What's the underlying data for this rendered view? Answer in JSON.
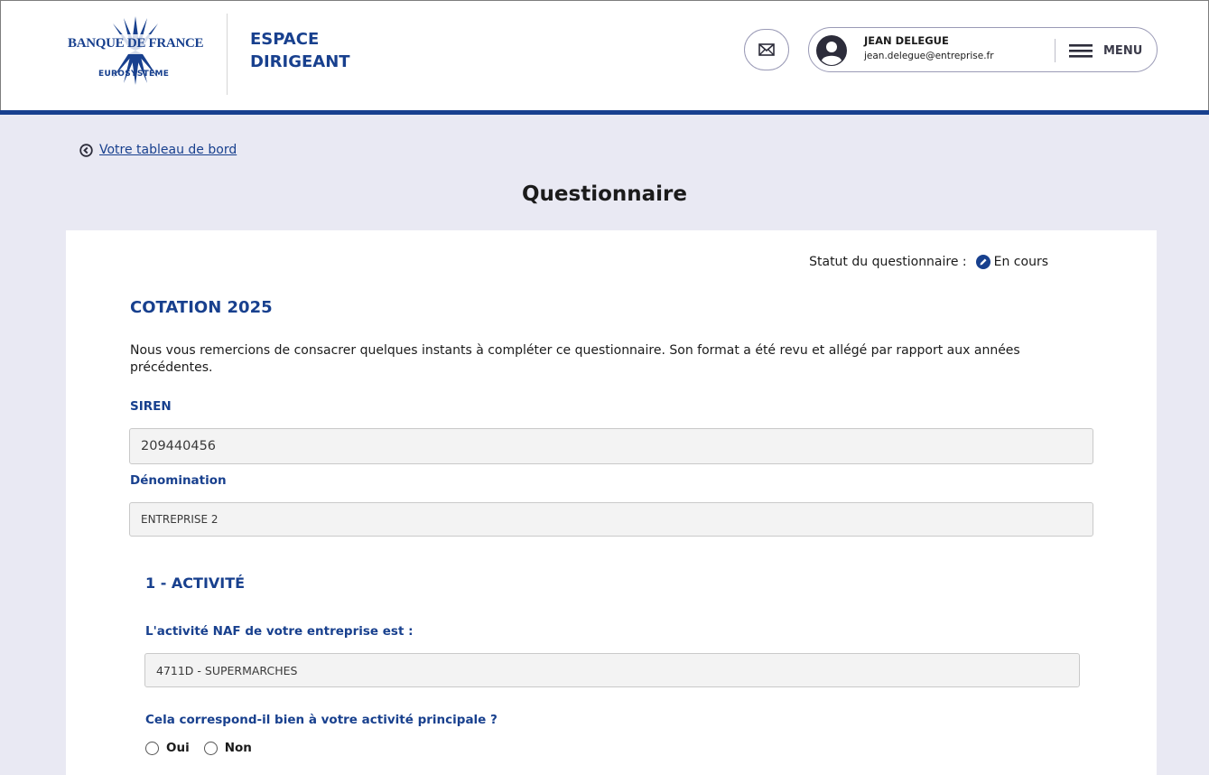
{
  "header": {
    "logo": {
      "name": "BANQUE DE FRANCE",
      "subtitle": "EUROSYSTÈME"
    },
    "app_title_line1": "ESPACE",
    "app_title_line2": "DIRIGEANT",
    "mail_icon": "envelope-icon",
    "user": {
      "name": "JEAN DELEGUE",
      "email": "jean.delegue@entreprise.fr",
      "avatar_icon": "user-circle-icon"
    },
    "menu_label": "MENU",
    "menu_icon": "hamburger-icon"
  },
  "breadcrumb": {
    "back_label": "Votre tableau de bord",
    "back_icon": "chevron-left-circle-icon"
  },
  "page_title": "Questionnaire",
  "questionnaire": {
    "status_label": "Statut du questionnaire :",
    "status_value": "En cours",
    "status_icon": "pencil-circle-icon",
    "title": "COTATION 2025",
    "intro": "Nous vous remercions de consacrer quelques instants à compléter ce questionnaire. Son format a été revu et allégé par rapport aux années précédentes.",
    "siren_label": "SIREN",
    "siren_value": "209440456",
    "denomination_label": "Dénomination",
    "denomination_value": "ENTREPRISE 2",
    "section1": {
      "title": "1 - ACTIVITÉ",
      "naf_label": "L'activité NAF de votre entreprise est :",
      "naf_value": "4711D - SUPERMARCHES",
      "question": "Cela correspond-il bien à votre activité principale ?",
      "options": [
        "Oui",
        "Non"
      ]
    }
  },
  "colors": {
    "brand_blue": "#18408e",
    "page_bg": "#e9e9f3",
    "card_bg": "#ffffff"
  }
}
